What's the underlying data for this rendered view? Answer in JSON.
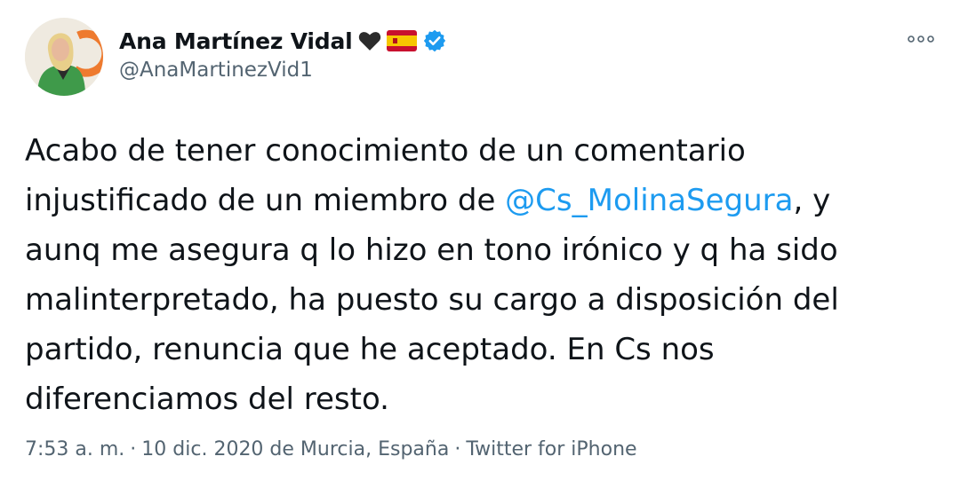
{
  "author": {
    "display_name": "Ana Martínez Vidal",
    "handle": "@AnaMartinezVid1",
    "badges": [
      "black-heart-icon",
      "spain-flag-icon",
      "verified-badge-icon"
    ],
    "verified_color": "#1d9bf0"
  },
  "tweet": {
    "lines": [
      [
        {
          "text": "Acabo de tener conocimiento de un comentario"
        }
      ],
      [
        {
          "text": "injustificado de un miembro de "
        },
        {
          "text": "@Cs_MolinaSegura",
          "mention": true
        },
        {
          "text": ", y"
        }
      ],
      [
        {
          "text": "aunq me asegura q lo hizo en tono irónico y q ha sido"
        }
      ],
      [
        {
          "text": "malinterpretado, ha puesto su cargo a disposición del"
        }
      ],
      [
        {
          "text": "partido, renuncia que he aceptado. En Cs nos"
        }
      ],
      [
        {
          "text": "diferenciamos del resto."
        }
      ]
    ]
  },
  "meta": {
    "time": "7:53 a. m.",
    "separator": "·",
    "date_location": "10 dic. 2020 de Murcia, España",
    "source": "Twitter for iPhone"
  },
  "colors": {
    "text": "#0f1419",
    "secondary": "#536471",
    "link": "#1d9bf0"
  }
}
